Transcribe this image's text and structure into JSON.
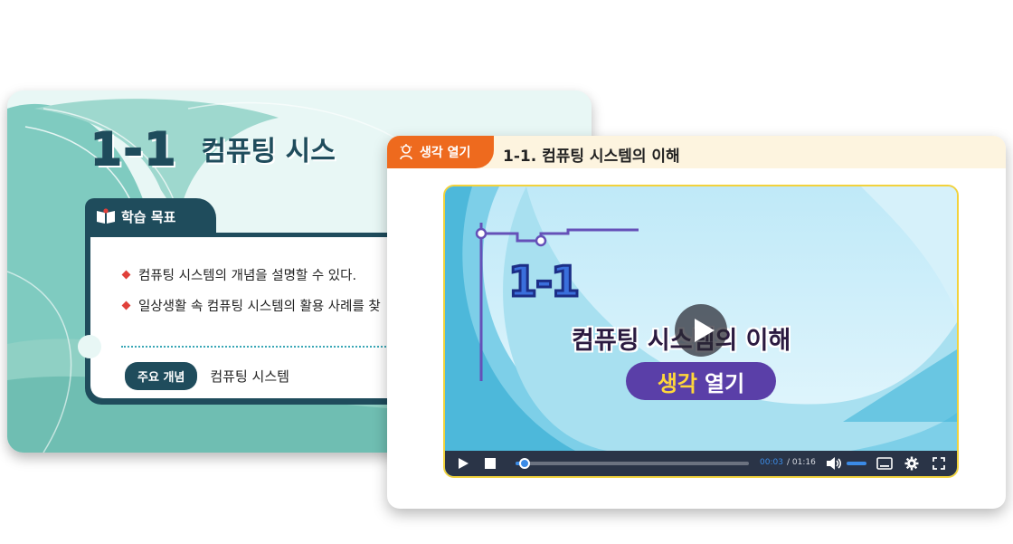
{
  "back_card": {
    "lesson_number": "1-1",
    "lesson_title": "컴퓨팅 시스",
    "goals_label": "학습 목표",
    "goals": [
      "컴퓨팅 시스템의 개념을 설명할 수 있다.",
      "일상생활 속 컴퓨팅 시스템의 활용 사례를 찾"
    ],
    "key_concept_label": "주요 개념",
    "key_concept_value": "컴퓨팅 시스템"
  },
  "front_card": {
    "tab_label": "생각 열기",
    "title": "1-1. 컴퓨팅 시스템의 이해",
    "video": {
      "slide_number": "1-1",
      "slide_title": "컴퓨팅 시스템의 이해",
      "slide_pill_a": "생각",
      "slide_pill_b": "열기",
      "current_time": "00:03",
      "total_time": "/ 01:16",
      "progress_fraction": 0.04
    }
  },
  "icons": [
    "book-icon",
    "lightbulb-person-icon",
    "play-icon",
    "stop-icon",
    "volume-icon",
    "subtitles-icon",
    "gear-icon",
    "fullscreen-icon"
  ],
  "colors": {
    "teal_dark": "#1f4c5c",
    "orange_tab": "#ee6a1e",
    "video_border": "#f2d23c",
    "accent_blue": "#3b8be6"
  }
}
